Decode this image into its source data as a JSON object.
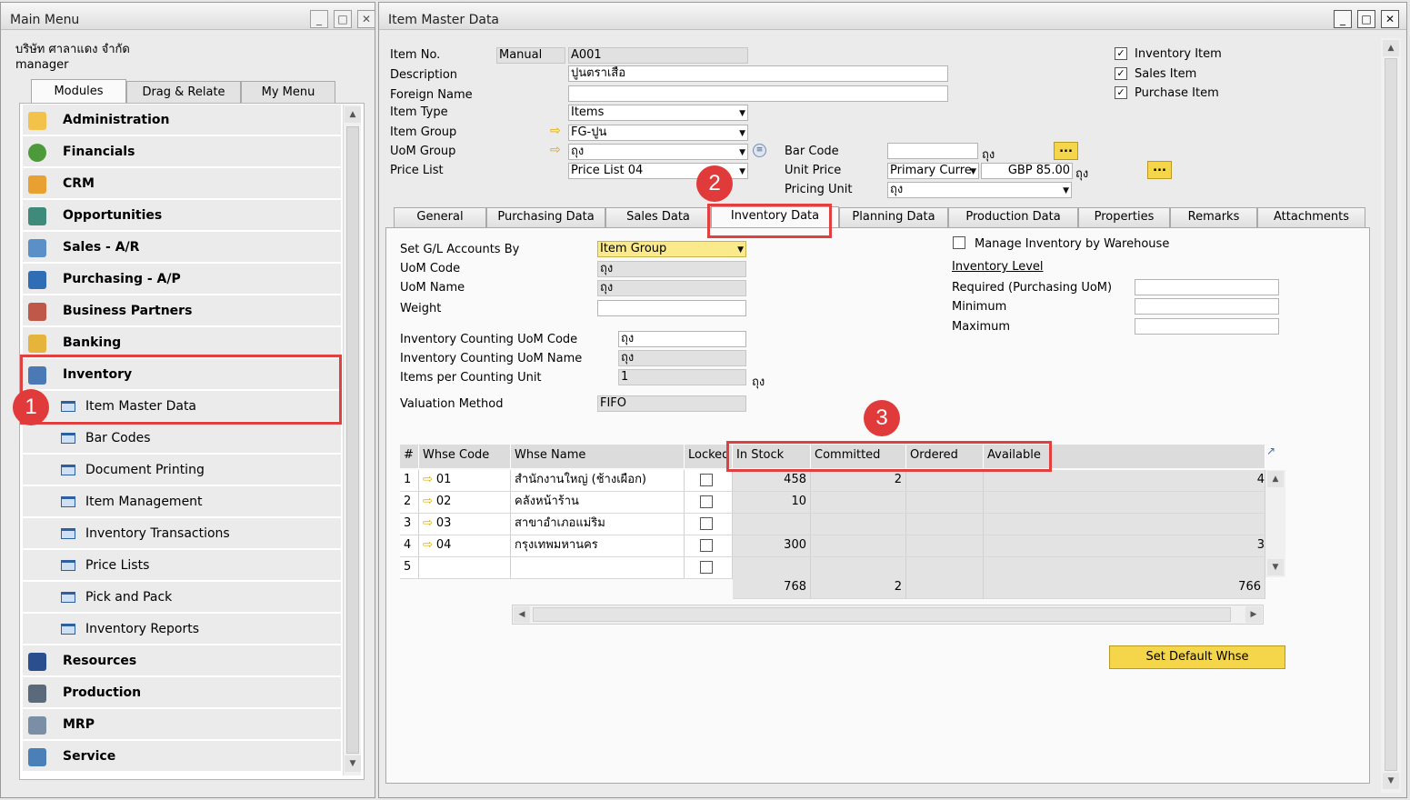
{
  "main_menu": {
    "title": "Main Menu",
    "company": "บริษัท ศาลาแดง จำกัด",
    "user": "manager",
    "tabs": [
      "Modules",
      "Drag & Relate",
      "My Menu"
    ],
    "modules": [
      "Administration",
      "Financials",
      "CRM",
      "Opportunities",
      "Sales - A/R",
      "Purchasing - A/P",
      "Business Partners",
      "Banking",
      "Inventory"
    ],
    "inventory_sub": [
      "Item Master Data",
      "Bar Codes",
      "Document Printing",
      "Item Management",
      "Inventory Transactions",
      "Price Lists",
      "Pick and Pack",
      "Inventory Reports"
    ],
    "modules_after": [
      "Resources",
      "Production",
      "MRP",
      "Service"
    ]
  },
  "item_master": {
    "title": "Item Master Data",
    "item_no_label": "Item No.",
    "item_no_series": "Manual",
    "item_no": "A001",
    "description_label": "Description",
    "description": "ปูนตราเสือ",
    "foreign_name_label": "Foreign Name",
    "foreign_name": "",
    "item_type_label": "Item Type",
    "item_type": "Items",
    "item_group_label": "Item Group",
    "item_group": "FG-ปูน",
    "uom_group_label": "UoM Group",
    "uom_group": "ถุง",
    "price_list_label": "Price List",
    "price_list": "Price List 04",
    "bar_code_label": "Bar Code",
    "bar_code": "",
    "bar_code_unit": "ถุง",
    "unit_price_label": "Unit Price",
    "unit_price_currency": "Primary Curre",
    "unit_price": "GBP 85.00",
    "unit_price_unit": "ถุง",
    "pricing_unit_label": "Pricing Unit",
    "pricing_unit": "ถุง",
    "inventory_item": "Inventory Item",
    "sales_item": "Sales Item",
    "purchase_item": "Purchase Item",
    "browse": "..."
  },
  "tabs": [
    "General",
    "Purchasing Data",
    "Sales Data",
    "Inventory Data",
    "Planning Data",
    "Production Data",
    "Properties",
    "Remarks",
    "Attachments"
  ],
  "inventory": {
    "gl_label": "Set G/L Accounts By",
    "gl_value": "Item Group",
    "uom_code_label": "UoM Code",
    "uom_code": "ถุง",
    "uom_name_label": "UoM Name",
    "uom_name": "ถุง",
    "weight_label": "Weight",
    "weight": "",
    "count_code_label": "Inventory Counting UoM Code",
    "count_code": "ถุง",
    "count_name_label": "Inventory Counting UoM Name",
    "count_name": "ถุง",
    "per_unit_label": "Items per Counting Unit",
    "per_unit": "1",
    "per_unit_suffix": "ถุง",
    "valuation_label": "Valuation Method",
    "valuation": "FIFO",
    "manage_wh": "Manage Inventory by Warehouse",
    "inv_level": "Inventory Level",
    "required_label": "Required (Purchasing UoM)",
    "minimum_label": "Minimum",
    "maximum_label": "Maximum"
  },
  "whse_table": {
    "headers": [
      "#",
      "Whse Code",
      "Whse Name",
      "Locked",
      "In Stock",
      "Committed",
      "Ordered",
      "Available"
    ],
    "rows": [
      {
        "n": "1",
        "code": "01",
        "name": "สำนักงานใหญ่ (ช้างเผือก)",
        "in_stock": "458",
        "committed": "2",
        "edge": "4"
      },
      {
        "n": "2",
        "code": "02",
        "name": "คลังหน้าร้าน",
        "in_stock": "10",
        "committed": "",
        "edge": ""
      },
      {
        "n": "3",
        "code": "03",
        "name": "สาขาอำเภอแม่ริม",
        "in_stock": "",
        "committed": "",
        "edge": ""
      },
      {
        "n": "4",
        "code": "04",
        "name": "กรุงเทพมหานคร",
        "in_stock": "300",
        "committed": "",
        "edge": "3"
      },
      {
        "n": "5",
        "code": "",
        "name": "",
        "in_stock": "",
        "committed": "",
        "edge": ""
      }
    ],
    "totals": {
      "in_stock": "768",
      "committed": "2",
      "available": "766"
    }
  },
  "set_default_whse": "Set Default Whse",
  "callouts": [
    "1",
    "2",
    "3"
  ]
}
